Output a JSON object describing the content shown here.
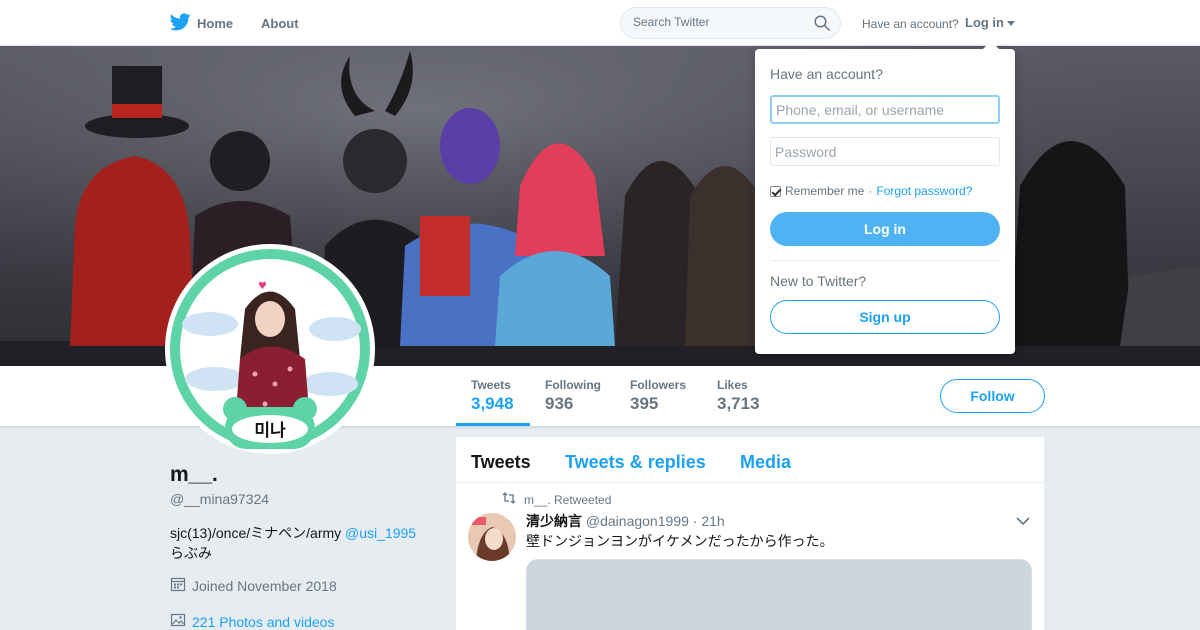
{
  "nav": {
    "home_label": "Home",
    "about_label": "About",
    "search_placeholder": "Search Twitter",
    "have_account": "Have an account?",
    "login_label": "Log in"
  },
  "colors": {
    "accent": "#1da1f2",
    "background": "#e6ecf0",
    "login_button": "#4fb2f3",
    "avatar_ring": "#5fd3a8"
  },
  "stats": [
    {
      "label": "Tweets",
      "value": "3,948",
      "active": true
    },
    {
      "label": "Following",
      "value": "936"
    },
    {
      "label": "Followers",
      "value": "395"
    },
    {
      "label": "Likes",
      "value": "3,713"
    }
  ],
  "follow_label": "Follow",
  "profile": {
    "name": "m__.",
    "handle": "@__mina97324",
    "bio_text": "sjc(13)/once/ミナペン/army ",
    "bio_mention": "@usi_1995",
    "bio_line2": "らぶみ",
    "avatar_text": "미나",
    "joined": "Joined November 2018",
    "photos": "221 Photos and videos"
  },
  "timeline": {
    "tabs": [
      "Tweets",
      "Tweets & replies",
      "Media"
    ],
    "tweet": {
      "retweeted_by": "m__. Retweeted",
      "name": "清少納言",
      "handle": "@dainagon1999",
      "time": "· 21h",
      "text": "壁ドンジョンヨンがイケメンだったから作った。"
    }
  },
  "login_dropdown": {
    "title": "Have an account?",
    "username_placeholder": "Phone, email, or username",
    "password_placeholder": "Password",
    "remember_label": "Remember me",
    "separator": "·",
    "forgot_label": "Forgot password?",
    "login_button": "Log in",
    "new_label": "New to Twitter?",
    "signup_button": "Sign up"
  }
}
